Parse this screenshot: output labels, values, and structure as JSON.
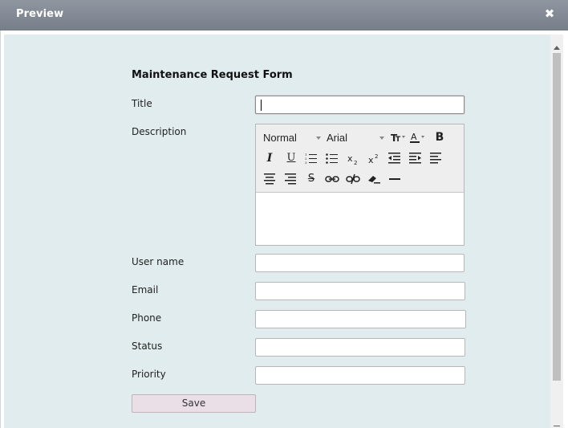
{
  "window": {
    "title": "Preview",
    "close_label": "✖"
  },
  "form": {
    "title": "Maintenance Request Form",
    "fields": {
      "title": {
        "label": "Title",
        "value": ""
      },
      "description": {
        "label": "Description",
        "value": ""
      },
      "user_name": {
        "label": "User name",
        "value": ""
      },
      "email": {
        "label": "Email",
        "value": ""
      },
      "phone": {
        "label": "Phone",
        "value": ""
      },
      "status": {
        "label": "Status",
        "value": ""
      },
      "priority": {
        "label": "Priority",
        "value": ""
      }
    },
    "save_label": "Save"
  },
  "editor": {
    "format_select": "Normal",
    "font_select": "Arial",
    "buttons": {
      "font_size": "font-size-icon",
      "text_color": "text-color-icon",
      "bold": "B",
      "italic": "I",
      "underline": "U",
      "ordered_list": "ordered-list-icon",
      "unordered_list": "unordered-list-icon",
      "subscript": "subscript-icon",
      "superscript": "superscript-icon",
      "outdent": "outdent-icon",
      "indent": "indent-icon",
      "align_left": "align-left-icon",
      "align_center": "align-center-icon",
      "align_right": "align-right-icon",
      "strikethrough": "S",
      "link": "link-icon",
      "unlink": "unlink-icon",
      "clear_format": "eraser-icon",
      "horizontal_rule": "horizontal-rule-icon"
    }
  }
}
